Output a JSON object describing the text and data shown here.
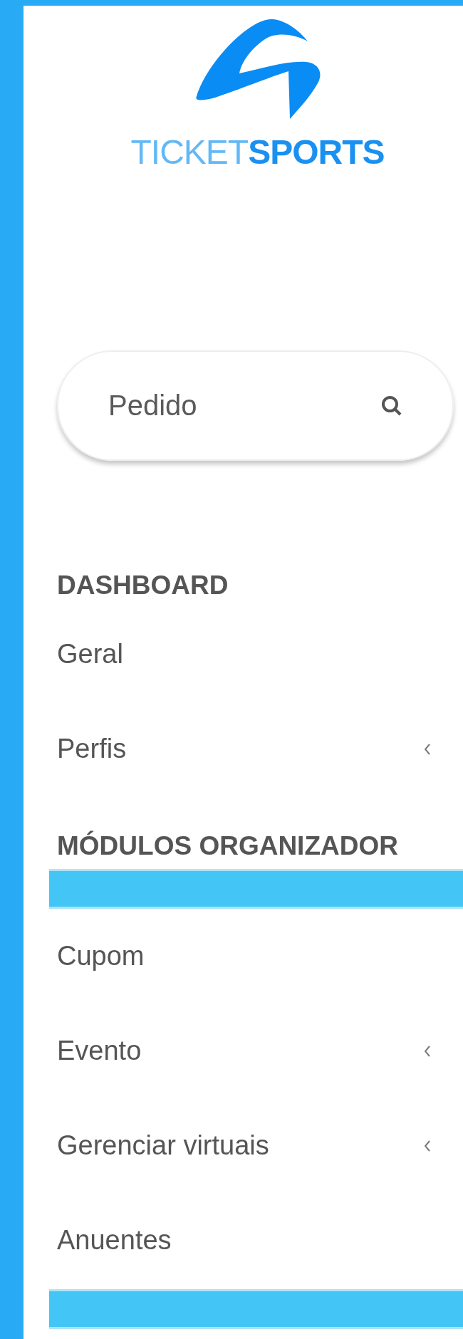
{
  "logo": {
    "wordmark": "TICKET**SPORTS**"
  },
  "search": {
    "placeholder": "Pedido"
  },
  "menu": [
    {
      "kind": "header",
      "label": "DASHBOARD"
    },
    {
      "kind": "link",
      "label": "Geral",
      "expandable": false
    },
    {
      "kind": "link",
      "label": "Perfis",
      "expandable": true
    },
    {
      "kind": "header",
      "label": "MÓDULOS ORGANIZADOR"
    },
    {
      "kind": "bar"
    },
    {
      "kind": "link",
      "label": "Cupom",
      "expandable": false
    },
    {
      "kind": "link",
      "label": "Evento",
      "expandable": true
    },
    {
      "kind": "link",
      "label": "Gerenciar virtuais",
      "expandable": true
    },
    {
      "kind": "link",
      "label": "Anuentes",
      "expandable": false
    },
    {
      "kind": "bar"
    }
  ]
}
